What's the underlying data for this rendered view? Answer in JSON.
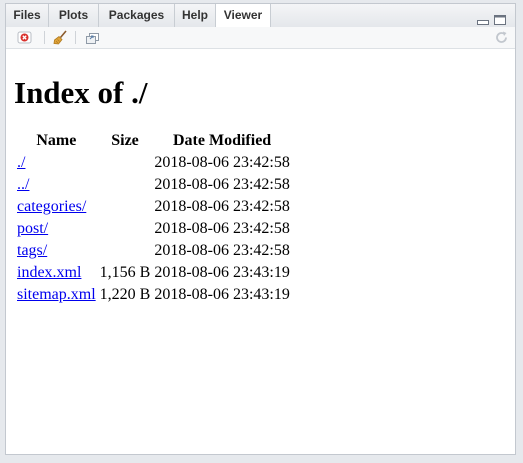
{
  "tabs": [
    {
      "label": "Files"
    },
    {
      "label": "Plots"
    },
    {
      "label": "Packages"
    },
    {
      "label": "Help"
    },
    {
      "label": "Viewer"
    }
  ],
  "active_tab": "Viewer",
  "toolbar": {
    "icons": [
      "remove-viewer-icon",
      "clear-broom-icon",
      "popout-window-icon",
      "refresh-icon"
    ]
  },
  "page": {
    "heading": "Index of ./",
    "columns": {
      "name": "Name",
      "size": "Size",
      "modified": "Date Modified"
    },
    "rows": [
      {
        "name": "./",
        "size": "",
        "modified": "2018-08-06 23:42:58"
      },
      {
        "name": "../",
        "size": "",
        "modified": "2018-08-06 23:42:58"
      },
      {
        "name": "categories/",
        "size": "",
        "modified": "2018-08-06 23:42:58"
      },
      {
        "name": "post/",
        "size": "",
        "modified": "2018-08-06 23:42:58"
      },
      {
        "name": "tags/",
        "size": "",
        "modified": "2018-08-06 23:42:58"
      },
      {
        "name": "index.xml",
        "size": "1,156 B",
        "modified": "2018-08-06 23:43:19"
      },
      {
        "name": "sitemap.xml",
        "size": "1,220 B",
        "modified": "2018-08-06 23:43:19"
      }
    ]
  },
  "colors": {
    "link": "#0000ee",
    "remove_icon": "#d9302c"
  }
}
